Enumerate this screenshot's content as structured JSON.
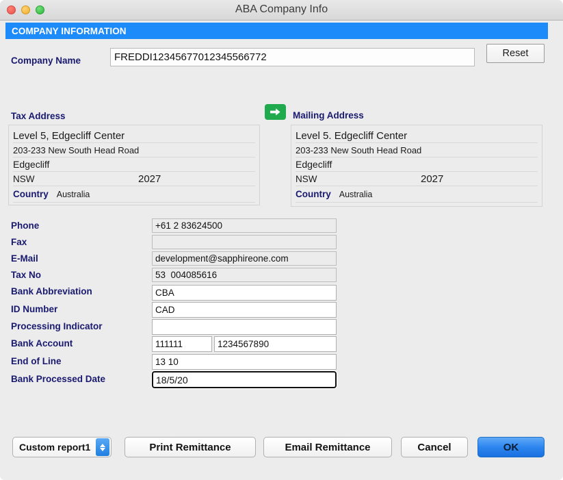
{
  "window": {
    "title": "ABA Company Info",
    "traffic_lights": [
      "close-button",
      "minimize-button",
      "zoom-button"
    ]
  },
  "banner": {
    "title": "COMPANY INFORMATION"
  },
  "company": {
    "label": "Company Name",
    "value": "FREDDI12345677012345566772",
    "reset_label": "Reset"
  },
  "tax_address": {
    "title": "Tax Address",
    "line1": "Level 5, Edgecliff Center",
    "line2": "203-233 New South Head Road",
    "line3": "Edgecliff",
    "state": "NSW",
    "postcode": "2027",
    "country_label": "Country",
    "country": "Australia"
  },
  "mailing_address": {
    "title": "Mailing Address",
    "line1": "Level 5. Edgecliff Center",
    "line2": "203-233 New South Head Road",
    "line3": "Edgecliff",
    "state": "NSW",
    "postcode": "2027",
    "country_label": "Country",
    "country": "Australia"
  },
  "fields": {
    "phone_label": "Phone",
    "phone_value": "+61 2 83624500",
    "fax_label": "Fax",
    "fax_value": "",
    "email_label": "E-Mail",
    "email_value": "development@sapphireone.com",
    "taxno_label": "Tax No",
    "taxno_value": "53  004085616",
    "bankabbr_label": "Bank Abbreviation",
    "bankabbr_value": "CBA",
    "idnumber_label": "ID Number",
    "idnumber_value": "CAD",
    "processing_label": "Processing Indicator",
    "processing_value": "",
    "bankaccount_label": "Bank Account",
    "bankaccount_bsb": "111111",
    "bankaccount_number": "1234567890",
    "endofline_label": "End of Line",
    "endofline_value": "13 10",
    "bankdate_label": "Bank Processed Date",
    "bankdate_value": "18/5/20"
  },
  "buttons": {
    "report_select": "Custom report1",
    "print_remittance": "Print Remittance",
    "email_remittance": "Email Remittance",
    "cancel": "Cancel",
    "ok": "OK"
  },
  "colors": {
    "banner_blue": "#1e8bfb",
    "label_navy": "#191970",
    "accent_green": "#1faa4e",
    "ok_blue": "#2d86ef",
    "focus_ring": "#5b9bd8",
    "window_bg": "#ececec"
  }
}
